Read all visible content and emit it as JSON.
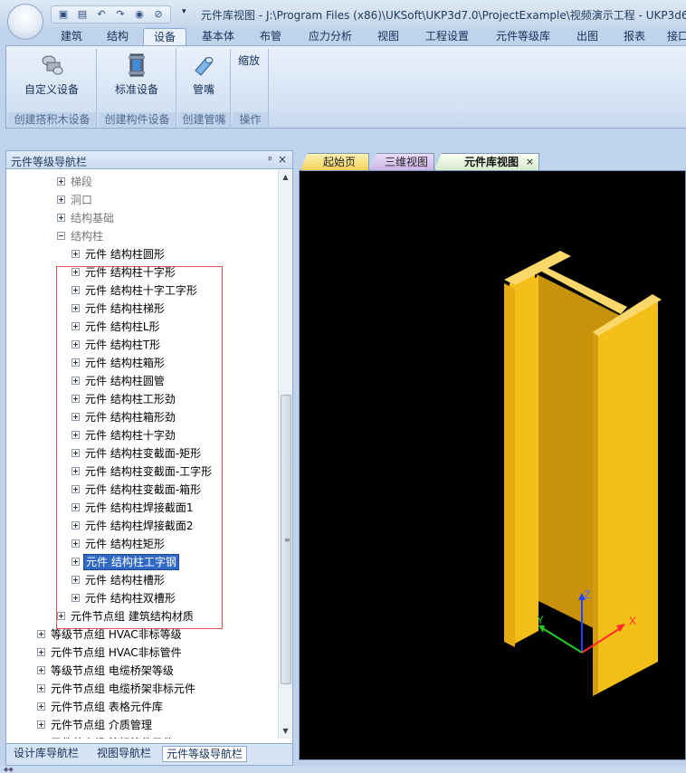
{
  "window": {
    "title": "元件库视图 - J:\\Program Files (x86)\\UKSoft\\UKP3d7.0\\ProjectExample\\视频演示工程 - UKP3d6",
    "qat_icons": [
      "save-icon",
      "save-as-icon",
      "undo-icon",
      "redo-icon",
      "eye-icon",
      "hide-icon"
    ],
    "qat_dropdown": "▾"
  },
  "ribbon": {
    "tabs": [
      {
        "label": "建筑"
      },
      {
        "label": "结构"
      },
      {
        "label": "设备"
      },
      {
        "label": "基本体"
      },
      {
        "label": "布管"
      },
      {
        "label": "应力分析"
      },
      {
        "label": "视图"
      },
      {
        "label": "工程设置"
      },
      {
        "label": "元件等级库"
      },
      {
        "label": "出图"
      },
      {
        "label": "报表"
      },
      {
        "label": "接口"
      }
    ],
    "active_tab": "设备",
    "groups": [
      {
        "button": "自定义设备",
        "label": "创建搭积木设备"
      },
      {
        "button": "标准设备",
        "label": "创建构件设备"
      },
      {
        "button": "管嘴",
        "label": "创建管嘴"
      },
      {
        "button": "缩放",
        "label": "操作"
      }
    ]
  },
  "navigator": {
    "title": "元件等级导航栏",
    "pin": "ᵖ",
    "close": "×",
    "tree": [
      {
        "label": "梯段",
        "expander": "plus",
        "gray": true
      },
      {
        "label": "洞口",
        "expander": "plus",
        "gray": true
      },
      {
        "label": "结构基础",
        "expander": "plus",
        "gray": true
      },
      {
        "label": "结构柱",
        "expander": "minus",
        "gray": true
      },
      {
        "label": "元件 结构柱圆形",
        "expander": "plus"
      },
      {
        "label": "元件 结构柱十字形",
        "expander": "plus"
      },
      {
        "label": "元件 结构柱十字工字形",
        "expander": "plus"
      },
      {
        "label": "元件 结构柱梯形",
        "expander": "plus"
      },
      {
        "label": "元件 结构柱L形",
        "expander": "plus"
      },
      {
        "label": "元件 结构柱T形",
        "expander": "plus"
      },
      {
        "label": "元件 结构柱箱形",
        "expander": "plus"
      },
      {
        "label": "元件 结构柱圆管",
        "expander": "plus"
      },
      {
        "label": "元件 结构柱工形劲",
        "expander": "plus"
      },
      {
        "label": "元件 结构柱箱形劲",
        "expander": "plus"
      },
      {
        "label": "元件 结构柱十字劲",
        "expander": "plus"
      },
      {
        "label": "元件 结构柱变截面-矩形",
        "expander": "plus"
      },
      {
        "label": "元件 结构柱变截面-工字形",
        "expander": "plus"
      },
      {
        "label": "元件 结构柱变截面-箱形",
        "expander": "plus"
      },
      {
        "label": "元件 结构柱焊接截面1",
        "expander": "plus"
      },
      {
        "label": "元件 结构柱焊接截面2",
        "expander": "plus"
      },
      {
        "label": "元件 结构柱矩形",
        "expander": "plus"
      },
      {
        "label": "元件 结构柱工字钢",
        "expander": "plus",
        "selected": true
      },
      {
        "label": "元件 结构柱槽形",
        "expander": "plus"
      },
      {
        "label": "元件 结构柱双槽形",
        "expander": "plus"
      },
      {
        "label": "元件节点组 建筑结构材质",
        "expander": "plus"
      },
      {
        "label": "等级节点组 HVAC非标等级",
        "expander": "plus"
      },
      {
        "label": "元件节点组 HVAC非标管件",
        "expander": "plus"
      },
      {
        "label": "等级节点组 电缆桥架等级",
        "expander": "plus"
      },
      {
        "label": "元件节点组 电缆桥架非标元件",
        "expander": "plus"
      },
      {
        "label": "元件节点组 表格元件库",
        "expander": "plus"
      },
      {
        "label": "元件节点组 介质管理",
        "expander": "plus"
      },
      {
        "label": "元件节点组 管标管件元件",
        "expander": "plus"
      }
    ],
    "bottom_tabs": [
      {
        "label": "设计库导航栏"
      },
      {
        "label": "视图导航栏"
      },
      {
        "label": "元件等级导航栏"
      }
    ]
  },
  "document": {
    "tabs": [
      {
        "label": "起始页"
      },
      {
        "label": "三维视图"
      },
      {
        "label": "元件库视图"
      }
    ],
    "tab_close": "×",
    "axes": {
      "x": "X",
      "y": "Y",
      "z": "Z"
    },
    "colors": {
      "beam": "#f5bf1a",
      "beam_dark": "#c8930a",
      "beam_light": "#fcd86a",
      "background": "#000000",
      "axis_x": "#ff2a2a",
      "axis_y": "#22cc22",
      "axis_z": "#2244ff"
    }
  }
}
